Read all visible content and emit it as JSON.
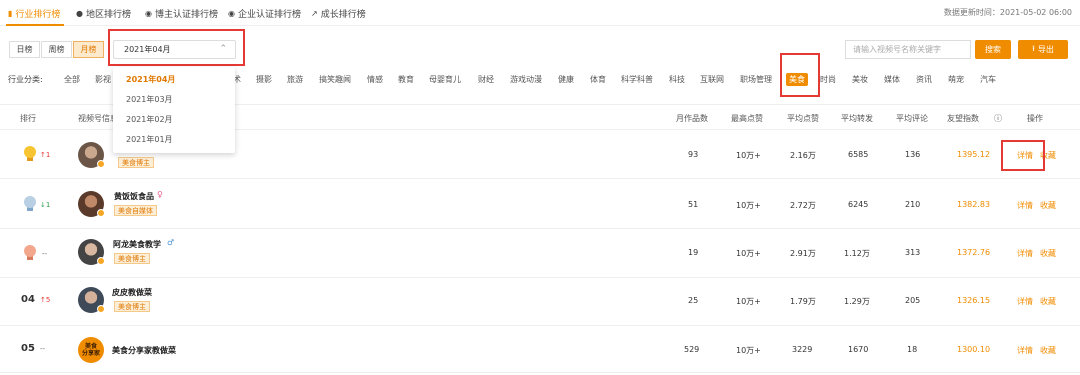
{
  "top_tabs": [
    {
      "label": "行业排行榜",
      "icon": "bar-chart-icon"
    },
    {
      "label": "地区排行榜",
      "icon": "location-pin-icon"
    },
    {
      "label": "博主认证排行榜",
      "icon": "badge-icon"
    },
    {
      "label": "企业认证排行榜",
      "icon": "badge-icon"
    },
    {
      "label": "成长排行榜",
      "icon": "growth-chart-icon"
    }
  ],
  "update_time": "数据更新时间：2021-05-02 06:00",
  "period_buttons": [
    "日榜",
    "周榜",
    "月榜"
  ],
  "month_select": {
    "value": "2021年04月"
  },
  "dropdown_options": [
    "2021年04月",
    "2021年03月",
    "2021年02月",
    "2021年01月"
  ],
  "search": {
    "placeholder": "请输入视频号名称关键字",
    "button": "搜索"
  },
  "export_label": "导出",
  "category_label": "行业分类:",
  "categories": [
    "全部",
    "影视",
    "术",
    "摄影",
    "旅游",
    "搞笑趣闻",
    "情感",
    "教育",
    "母婴育儿",
    "财经",
    "游戏动漫",
    "健康",
    "体育",
    "科学科普",
    "科技",
    "互联网",
    "职场管理",
    "美食",
    "时尚",
    "美妆",
    "媒体",
    "资讯",
    "萌宠",
    "汽车"
  ],
  "table_headers": [
    "排行",
    "视频号信息",
    "月作品数",
    "最高点赞",
    "平均点赞",
    "平均转发",
    "平均评论",
    "友望指数",
    "操作"
  ],
  "rows": [
    {
      "rank": "",
      "change": "↑1",
      "name": "",
      "tag": "美食博主",
      "works": "93",
      "max_likes": "10万+",
      "avg_likes": "2.16万",
      "avg_shares": "6585",
      "avg_comments": "136",
      "index": "1395.12",
      "detail": "详情",
      "collect": "收藏"
    },
    {
      "rank": "",
      "change": "↓1",
      "name": "黄饭饭食品",
      "tag": "美食自媒体",
      "works": "51",
      "max_likes": "10万+",
      "avg_likes": "2.72万",
      "avg_shares": "6245",
      "avg_comments": "210",
      "index": "1382.83",
      "detail": "详情",
      "collect": "收藏"
    },
    {
      "rank": "",
      "change": "--",
      "name": "阿龙美食教学",
      "tag": "美食博主",
      "works": "19",
      "max_likes": "10万+",
      "avg_likes": "2.91万",
      "avg_shares": "1.12万",
      "avg_comments": "313",
      "index": "1372.76",
      "detail": "详情",
      "collect": "收藏"
    },
    {
      "rank": "04",
      "change": "↑5",
      "name": "皮皮教做菜",
      "tag": "美食博主",
      "works": "25",
      "max_likes": "10万+",
      "avg_likes": "1.79万",
      "avg_shares": "1.29万",
      "avg_comments": "205",
      "index": "1326.15",
      "detail": "详情",
      "collect": "收藏"
    },
    {
      "rank": "05",
      "change": "--",
      "name": "美食分享家教做菜",
      "tag": "",
      "avatar_text": [
        "美食",
        "分享家"
      ],
      "works": "529",
      "max_likes": "10万+",
      "avg_likes": "3229",
      "avg_shares": "1670",
      "avg_comments": "18",
      "index": "1300.10",
      "detail": "详情",
      "collect": "收藏"
    }
  ],
  "colors": {
    "accent": "#f08c00",
    "highlight_box": "#e53935",
    "rank_up": "#e53935",
    "rank_down": "#2e9e4e"
  }
}
